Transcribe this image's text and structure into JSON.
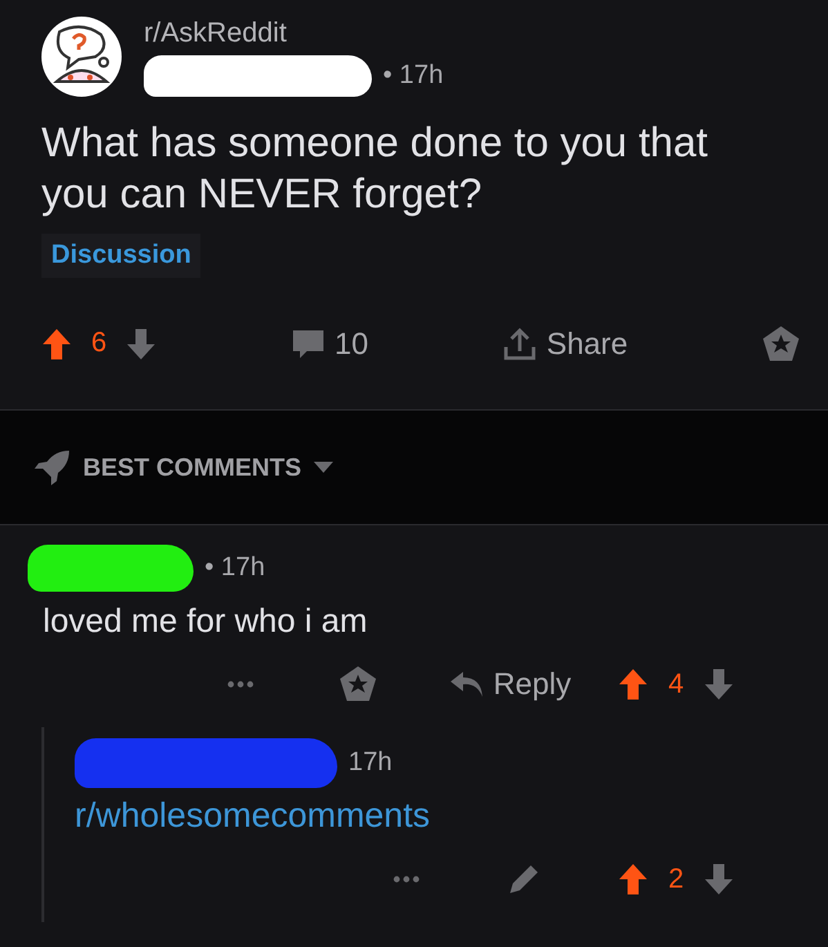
{
  "post": {
    "subreddit": "r/AskReddit",
    "author": {
      "color": "#ffffff"
    },
    "time": "• 17h",
    "title": "What has someone done to you that you can NEVER forget?",
    "flair": "Discussion",
    "votes": {
      "score": "6",
      "upvoted": true
    },
    "comments": "10",
    "share": "Share"
  },
  "sort": {
    "label": "BEST COMMENTS"
  },
  "comments": [
    {
      "author": {
        "color": "#22ee11"
      },
      "time": "• 17h",
      "body": "loved me for who i am",
      "reply": "Reply",
      "votes": {
        "score": "4",
        "upvoted": true
      },
      "kind": "text"
    },
    {
      "author": {
        "color": "#1530f0"
      },
      "time": "17h",
      "body": "r/wholesomecomments",
      "votes": {
        "score": "2",
        "upvoted": true
      },
      "kind": "link"
    }
  ]
}
